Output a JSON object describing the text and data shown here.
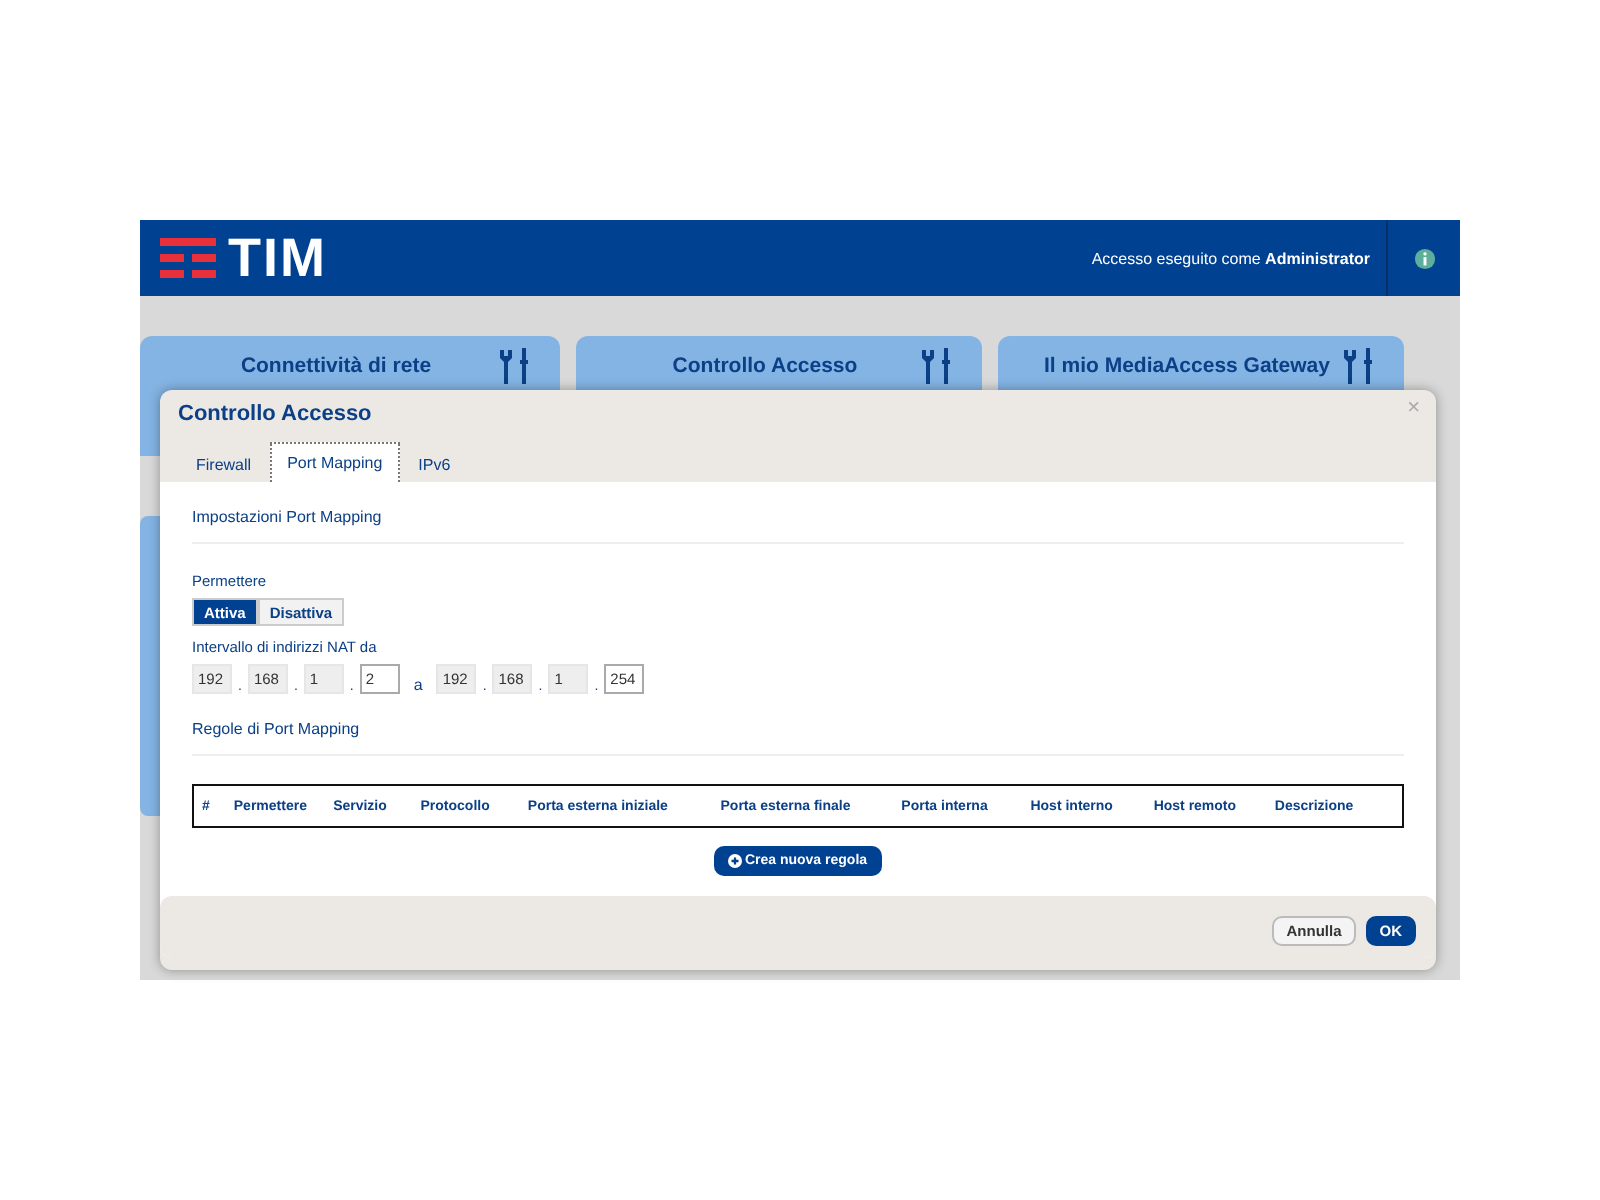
{
  "header": {
    "logo": "TIM",
    "login_label": "Accesso eseguito come",
    "user": "Administrator"
  },
  "cards": [
    {
      "title": "Connettività di rete"
    },
    {
      "title": "Controllo Accesso"
    },
    {
      "title": "Il mio MediaAccess Gateway"
    }
  ],
  "dialog": {
    "title": "Controllo Accesso",
    "close": "×",
    "tabs": [
      {
        "label": "Firewall",
        "selected": false
      },
      {
        "label": "Port Mapping",
        "selected": true
      },
      {
        "label": "IPv6",
        "selected": false
      }
    ],
    "section_title": "Impostazioni Port Mapping",
    "permit_label": "Permettere",
    "permit_options": [
      {
        "label": "Attiva",
        "selected": true
      },
      {
        "label": "Disattiva",
        "selected": false
      }
    ],
    "range_label": "Intervallo di indirizzi NAT da",
    "range_start": [
      {
        "value": "192",
        "disabled": true
      },
      {
        "value": "168",
        "disabled": true
      },
      {
        "value": "1",
        "disabled": true
      },
      {
        "value": "2",
        "disabled": false
      }
    ],
    "octet_sep": ".",
    "range_sep": "a",
    "range_end": [
      {
        "value": "192",
        "disabled": true
      },
      {
        "value": "168",
        "disabled": true
      },
      {
        "value": "1",
        "disabled": true
      },
      {
        "value": "254",
        "disabled": false
      }
    ],
    "rules_title": "Regole di Port Mapping",
    "table": {
      "columns": [
        "#",
        "Permettere",
        "Servizio",
        "Protocollo",
        "Porta esterna iniziale",
        "Porta esterna finale",
        "Porta interna",
        "Host interno",
        "Host remoto",
        "Descrizione"
      ]
    },
    "add_button": "Crea nuova regola",
    "buttons": [
      {
        "label": "Annulla",
        "kind": "secondary"
      },
      {
        "label": "OK",
        "kind": "primary"
      }
    ]
  }
}
